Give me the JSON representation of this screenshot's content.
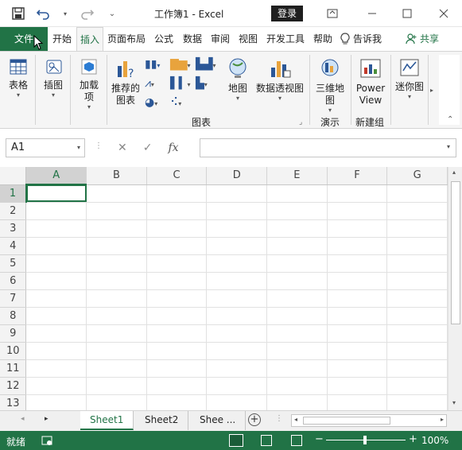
{
  "title_bar": {
    "doc_title": "工作簿1  -  Excel",
    "login_label": "登录"
  },
  "tabs": [
    {
      "label": "文件"
    },
    {
      "label": "开始"
    },
    {
      "label": "插入"
    },
    {
      "label": "页面布局"
    },
    {
      "label": "公式"
    },
    {
      "label": "数据"
    },
    {
      "label": "审阅"
    },
    {
      "label": "视图"
    },
    {
      "label": "开发工具"
    },
    {
      "label": "帮助"
    },
    {
      "label": "告诉我"
    },
    {
      "label": "共享"
    }
  ],
  "ribbon": {
    "table_label": "表格",
    "illustrations_label": "插图",
    "addins_label": "加载项",
    "recommended_charts_label": "推荐的图表",
    "maps_label": "地图",
    "pivotchart_label": "数据透视图",
    "map3d_label": "三维地图",
    "powerview_label": "Power View",
    "sparklines_label": "迷你图",
    "group_charts": "图表",
    "group_tours": "演示",
    "group_new": "新建组"
  },
  "formula_bar": {
    "name_box": "A1",
    "fx": "fx",
    "value": ""
  },
  "grid": {
    "columns": [
      "A",
      "B",
      "C",
      "D",
      "E",
      "F",
      "G"
    ],
    "rows": [
      "1",
      "2",
      "3",
      "4",
      "5",
      "6",
      "7",
      "8",
      "9",
      "10",
      "11",
      "12",
      "13"
    ],
    "selected_cell": "A1"
  },
  "sheets": [
    {
      "label": "Sheet1"
    },
    {
      "label": "Sheet2"
    },
    {
      "label": "Shee ..."
    }
  ],
  "status": {
    "mode": "就绪",
    "zoom": "100%"
  },
  "colors": {
    "accent": "#217346",
    "ribbon_bg": "#f5f5f5"
  }
}
